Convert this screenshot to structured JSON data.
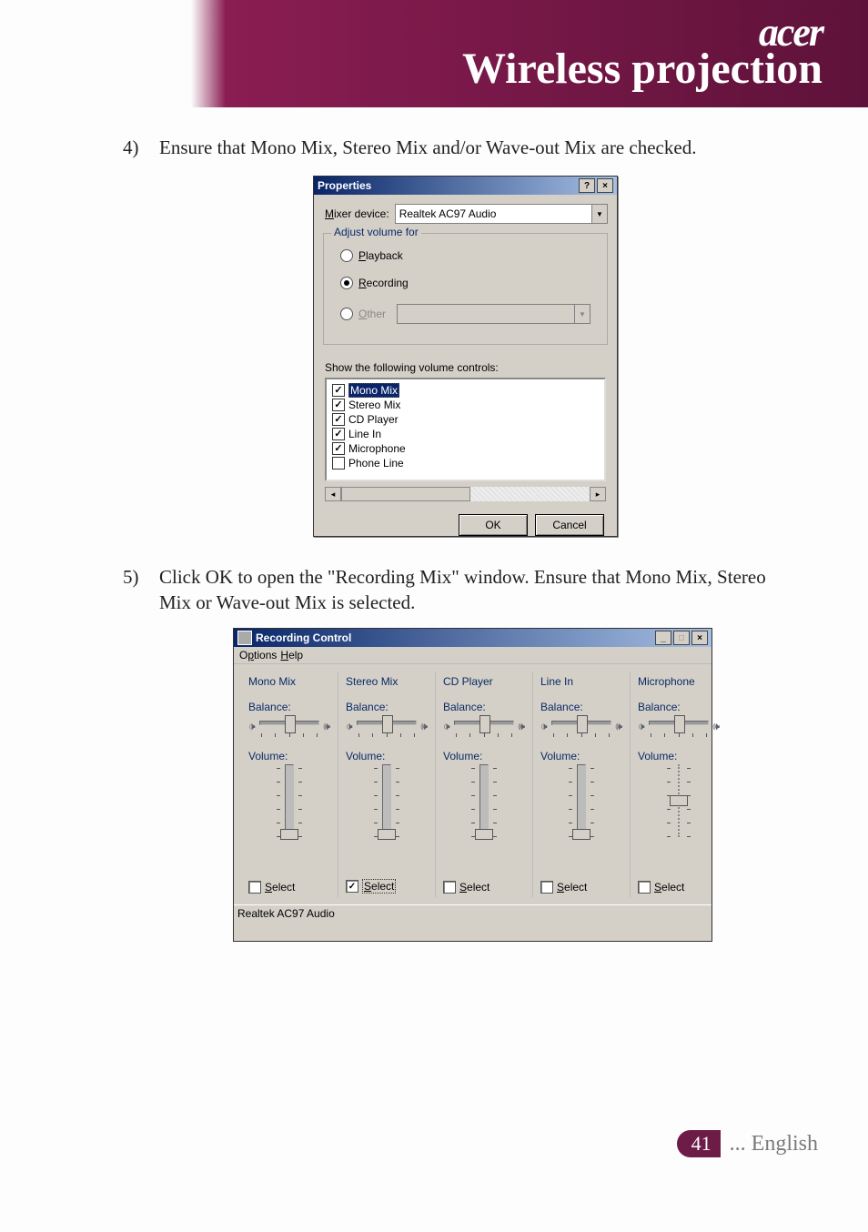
{
  "banner": {
    "logo": "acer",
    "title": "Wireless projection"
  },
  "step4": {
    "num": "4)",
    "text": "Ensure that Mono Mix, Stereo Mix and/or Wave-out Mix are checked."
  },
  "step5": {
    "num": "5)",
    "text": "Click OK to open the \"Recording Mix\" window. Ensure that Mono Mix, Stereo Mix or Wave-out Mix is selected."
  },
  "properties": {
    "title": "Properties",
    "help_btn": "?",
    "close_btn": "×",
    "mixer_label": "Mixer device:",
    "mixer_value": "Realtek AC97 Audio",
    "group_label": "Adjust volume for",
    "radios": {
      "playback": "Playback",
      "recording": "Recording",
      "other": "Other"
    },
    "show_label": "Show the following volume controls:",
    "items": [
      {
        "label": "Mono Mix",
        "checked": true,
        "selected": true
      },
      {
        "label": "Stereo Mix",
        "checked": true,
        "selected": false
      },
      {
        "label": "CD Player",
        "checked": true,
        "selected": false
      },
      {
        "label": "Line In",
        "checked": true,
        "selected": false
      },
      {
        "label": "Microphone",
        "checked": true,
        "selected": false
      },
      {
        "label": "Phone Line",
        "checked": false,
        "selected": false
      }
    ],
    "ok": "OK",
    "cancel": "Cancel"
  },
  "recording": {
    "title": "Recording Control",
    "min_btn": "_",
    "max_btn": "□",
    "close_btn": "×",
    "menu_options": "Options",
    "menu_help": "Help",
    "balance_label": "Balance:",
    "volume_label": "Volume:",
    "select_label": "Select",
    "channels": [
      {
        "name": "Mono Mix",
        "selected": false,
        "vol_pos": "bottom",
        "dotted": false
      },
      {
        "name": "Stereo Mix",
        "selected": true,
        "vol_pos": "bottom",
        "dotted": false
      },
      {
        "name": "CD Player",
        "selected": false,
        "vol_pos": "bottom",
        "dotted": false
      },
      {
        "name": "Line In",
        "selected": false,
        "vol_pos": "bottom",
        "dotted": false
      },
      {
        "name": "Microphone",
        "selected": false,
        "vol_pos": "mid",
        "dotted": true
      }
    ],
    "status": "Realtek AC97 Audio"
  },
  "footer": {
    "page": "41",
    "lang": "... English"
  }
}
